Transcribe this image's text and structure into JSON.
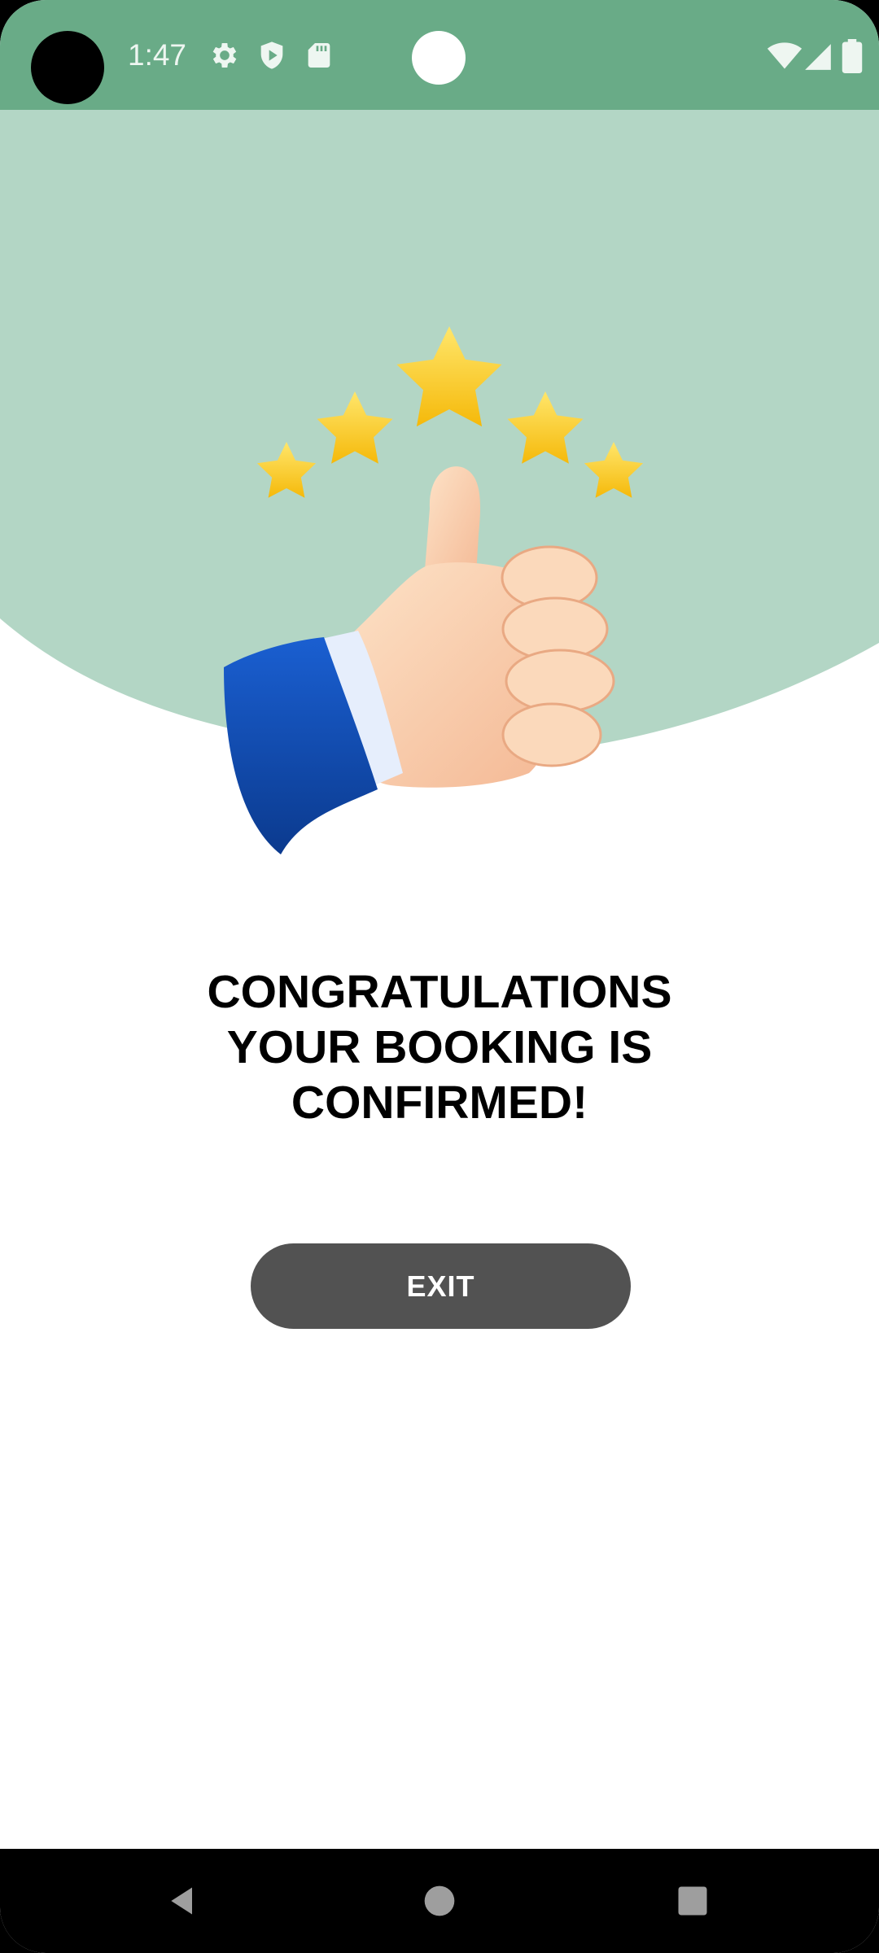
{
  "status_bar": {
    "time": "1:47",
    "icons": [
      "gear-icon",
      "shield-icon",
      "sd-card-icon",
      "wifi-icon",
      "cell-signal-icon",
      "battery-icon"
    ],
    "background_color": "#69ab87"
  },
  "hero": {
    "background_color": "#b3d6c5",
    "illustration": "thumbs-up-with-five-stars",
    "star_count": 5
  },
  "message": {
    "line1": "CONGRATULATIONS",
    "line2": "YOUR BOOKING IS",
    "line3": "CONFIRMED!"
  },
  "exit_button": {
    "label": "EXIT",
    "color": "#525252"
  },
  "nav_bar": {
    "icons": [
      "back-icon",
      "home-icon",
      "recents-icon"
    ]
  }
}
